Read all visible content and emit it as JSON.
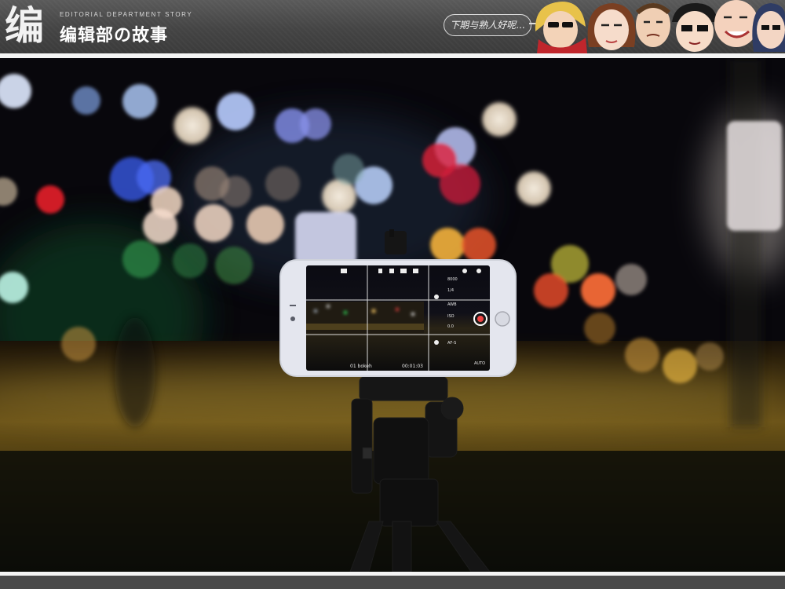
{
  "header": {
    "logo_char": "编",
    "subtitle": "EDITORIAL DEPARTMENT STORY",
    "title": "编辑部の故事",
    "speech_bubble": "下期与熟人好呢..."
  },
  "phone_screen": {
    "status_left": "01 bokeh",
    "status_right": "00:01:03",
    "setting_1": "8000",
    "setting_2": "1/4",
    "setting_3": "AWB",
    "setting_4": "ISO",
    "setting_5": "0.0",
    "setting_6": "AF-S",
    "setting_7": "AUTO"
  },
  "colors": {
    "header_bg": "#444444",
    "photo_bg": "#07060a",
    "bubble_border": "#dddddd"
  }
}
